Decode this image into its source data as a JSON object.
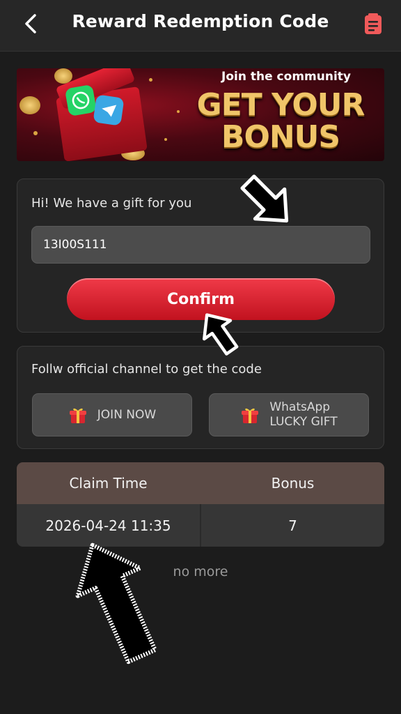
{
  "header": {
    "title": "Reward Redemption Code",
    "back_icon": "chevron-left-icon",
    "records_icon": "clipboard-list-icon"
  },
  "banner": {
    "subtitle": "Join the community",
    "headline": "GET YOUR BONUS"
  },
  "redeem": {
    "label": "Hi! We have a gift for you",
    "code_value": "13I00S111",
    "confirm_label": "Confirm"
  },
  "channel": {
    "label": "Follw official channel to get the code",
    "join_label": "JOIN NOW",
    "whatsapp_line1": "WhatsApp",
    "whatsapp_line2": "LUCKY GIFT"
  },
  "history": {
    "columns": [
      "Claim Time",
      "Bonus"
    ],
    "rows": [
      {
        "claim_time": "2026-04-24 11:35",
        "bonus": "7"
      }
    ],
    "footer": "no more"
  },
  "colors": {
    "background": "#1c1c1c",
    "accent_red": "#e02a38",
    "header_row": "#5b4a45"
  }
}
